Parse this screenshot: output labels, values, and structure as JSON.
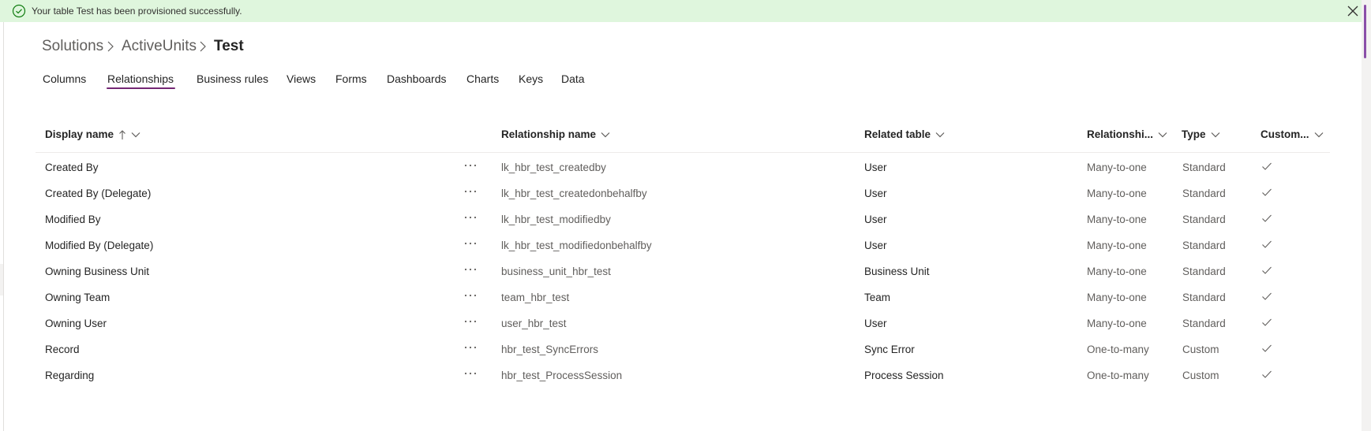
{
  "banner": {
    "message": "Your table Test has been provisioned successfully.",
    "icon": "success-check-circle-icon",
    "close_icon": "close-icon",
    "color": "#dff6dd"
  },
  "breadcrumb": [
    "Solutions",
    "ActiveUnits",
    "Test"
  ],
  "tabs": [
    "Columns",
    "Relationships",
    "Business rules",
    "Views",
    "Forms",
    "Dashboards",
    "Charts",
    "Keys",
    "Data"
  ],
  "active_tab": "Relationships",
  "accent_color": "#742774",
  "table": {
    "columns": [
      {
        "label": "Display name",
        "sort": "ascending"
      },
      {
        "label": "Relationship name"
      },
      {
        "label": "Related table"
      },
      {
        "label": "Relationshi..."
      },
      {
        "label": "Type"
      },
      {
        "label": "Custom..."
      }
    ],
    "rows": [
      {
        "display_name": "Created By",
        "relationship_name": "lk_hbr_test_createdby",
        "related_table": "User",
        "relationship_type": "Many-to-one",
        "type": "Standard",
        "customizable": true
      },
      {
        "display_name": "Created By (Delegate)",
        "relationship_name": "lk_hbr_test_createdonbehalfby",
        "related_table": "User",
        "relationship_type": "Many-to-one",
        "type": "Standard",
        "customizable": true
      },
      {
        "display_name": "Modified By",
        "relationship_name": "lk_hbr_test_modifiedby",
        "related_table": "User",
        "relationship_type": "Many-to-one",
        "type": "Standard",
        "customizable": true
      },
      {
        "display_name": "Modified By (Delegate)",
        "relationship_name": "lk_hbr_test_modifiedonbehalfby",
        "related_table": "User",
        "relationship_type": "Many-to-one",
        "type": "Standard",
        "customizable": true
      },
      {
        "display_name": "Owning Business Unit",
        "relationship_name": "business_unit_hbr_test",
        "related_table": "Business Unit",
        "relationship_type": "Many-to-one",
        "type": "Standard",
        "customizable": true
      },
      {
        "display_name": "Owning Team",
        "relationship_name": "team_hbr_test",
        "related_table": "Team",
        "relationship_type": "Many-to-one",
        "type": "Standard",
        "customizable": true
      },
      {
        "display_name": "Owning User",
        "relationship_name": "user_hbr_test",
        "related_table": "User",
        "relationship_type": "Many-to-one",
        "type": "Standard",
        "customizable": true
      },
      {
        "display_name": "Record",
        "relationship_name": "hbr_test_SyncErrors",
        "related_table": "Sync Error",
        "relationship_type": "One-to-many",
        "type": "Custom",
        "customizable": true
      },
      {
        "display_name": "Regarding",
        "relationship_name": "hbr_test_ProcessSession",
        "related_table": "Process Session",
        "relationship_type": "One-to-many",
        "type": "Custom",
        "customizable": true
      }
    ]
  }
}
